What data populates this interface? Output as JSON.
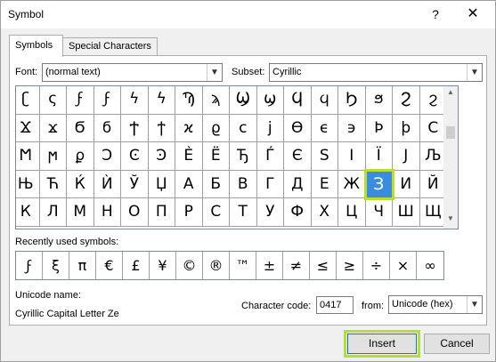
{
  "window": {
    "title": "Symbol",
    "help_icon": "?",
    "close_icon": "✕"
  },
  "tabs": [
    {
      "label": "Symbols",
      "active": true
    },
    {
      "label": "Special Characters",
      "active": false
    }
  ],
  "font": {
    "label": "Font:",
    "value": "(normal text)"
  },
  "subset": {
    "label": "Subset:",
    "value": "Cyrillic"
  },
  "symbol_grid": {
    "rows": [
      [
        "ʗ",
        "ς",
        "ϝ",
        "ϝ",
        "ϟ",
        "ϟ",
        "Ϡ",
        "ϡ",
        "Ϣ",
        "ϣ",
        "Ϥ",
        "ϥ",
        "Ϧ",
        "ϧ",
        "Ϩ",
        "ϩ"
      ],
      [
        "Ϫ",
        "ϫ",
        "Ϭ",
        "ϭ",
        "Ϯ",
        "ϯ",
        "ϰ",
        "ϱ",
        "ϲ",
        "ϳ",
        "ϴ",
        "ϵ",
        "϶",
        "Ϸ",
        "ϸ",
        "Ϲ"
      ],
      [
        "Ϻ",
        "ϻ",
        "ϼ",
        "Ͻ",
        "Ͼ",
        "Ͽ",
        "Ѐ",
        "Ё",
        "Ђ",
        "Ѓ",
        "Є",
        "Ѕ",
        "І",
        "Ї",
        "Ј",
        "Љ"
      ],
      [
        "Њ",
        "Ћ",
        "Ќ",
        "Ѝ",
        "Ў",
        "Џ",
        "А",
        "Б",
        "В",
        "Г",
        "Д",
        "Е",
        "Ж",
        "З",
        "И",
        "Й"
      ],
      [
        "К",
        "Л",
        "М",
        "Н",
        "О",
        "П",
        "Р",
        "С",
        "Т",
        "У",
        "Ф",
        "Х",
        "Ц",
        "Ч",
        "Ш",
        "Щ"
      ]
    ],
    "selected": {
      "row": 3,
      "col": 13
    }
  },
  "recently_used": {
    "label": "Recently used symbols:",
    "symbols": [
      "ϝ",
      "ξ",
      "π",
      "€",
      "£",
      "¥",
      "©",
      "®",
      "™",
      "±",
      "≠",
      "≤",
      "≥",
      "÷",
      "×",
      "∞"
    ]
  },
  "unicode_name": {
    "label": "Unicode name:",
    "value": "Cyrillic Capital Letter Ze"
  },
  "character_code": {
    "label": "Character code:",
    "value": "0417"
  },
  "from": {
    "label": "from:",
    "value": "Unicode (hex)"
  },
  "buttons": {
    "insert": "Insert",
    "cancel": "Cancel"
  },
  "colors": {
    "selection": "#3a8cde",
    "highlight": "#b5e02e"
  }
}
